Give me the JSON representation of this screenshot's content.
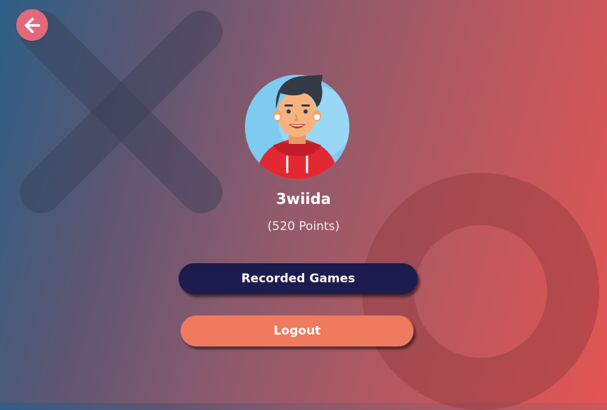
{
  "profile": {
    "username": "3wiida",
    "points_prefix": "(",
    "points_value": "520",
    "points_suffix": " Points)"
  },
  "actions": {
    "recorded_games_label": "Recorded Games",
    "logout_label": "Logout"
  },
  "icons": {
    "back": "arrow-left-icon",
    "avatar": "user-avatar",
    "background_x": "x-mark-icon",
    "background_o": "o-ring-icon"
  },
  "colors": {
    "back_button": "#e0697a",
    "recorded_games_button": "#1c1c4e",
    "logout_button": "#ef7a5e",
    "gradient_start": "#2d5f86",
    "gradient_end": "#e35552"
  }
}
